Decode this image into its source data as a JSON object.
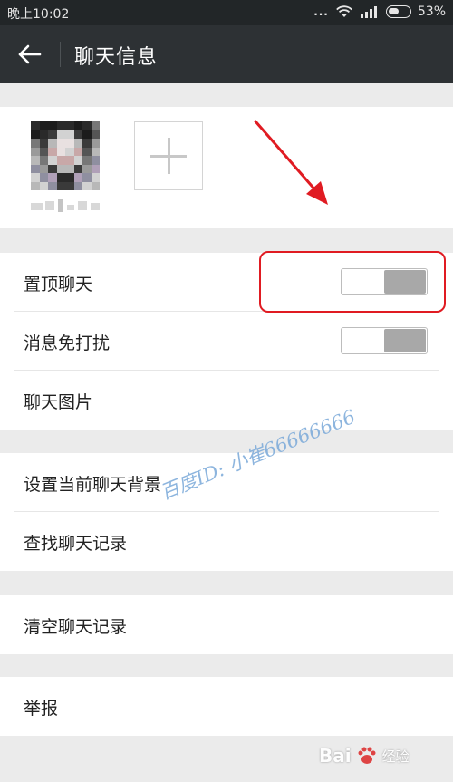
{
  "status_bar": {
    "time": "晚上10:02",
    "dots": "...",
    "battery": "53%"
  },
  "app_bar": {
    "back_icon": "arrow-left-icon",
    "title": "聊天信息"
  },
  "members": {
    "add_icon": "plus-icon"
  },
  "settings": {
    "group1": [
      {
        "label": "置顶聊天",
        "toggle": false
      },
      {
        "label": "消息免打扰",
        "toggle": false
      },
      {
        "label": "聊天图片"
      }
    ],
    "group2": [
      {
        "label": "设置当前聊天背景"
      },
      {
        "label": "查找聊天记录"
      }
    ],
    "group3": [
      {
        "label": "清空聊天记录"
      }
    ],
    "group4": [
      {
        "label": "举报"
      }
    ]
  },
  "watermark": "百度ID: 小崔66666666",
  "baidu_logo": {
    "text": "Bai",
    "suffix": "经验"
  },
  "colors": {
    "app_bar": "#2d3134",
    "status_bar": "#222628",
    "annotation": "#e01b22",
    "page_bg": "#ebebeb"
  }
}
